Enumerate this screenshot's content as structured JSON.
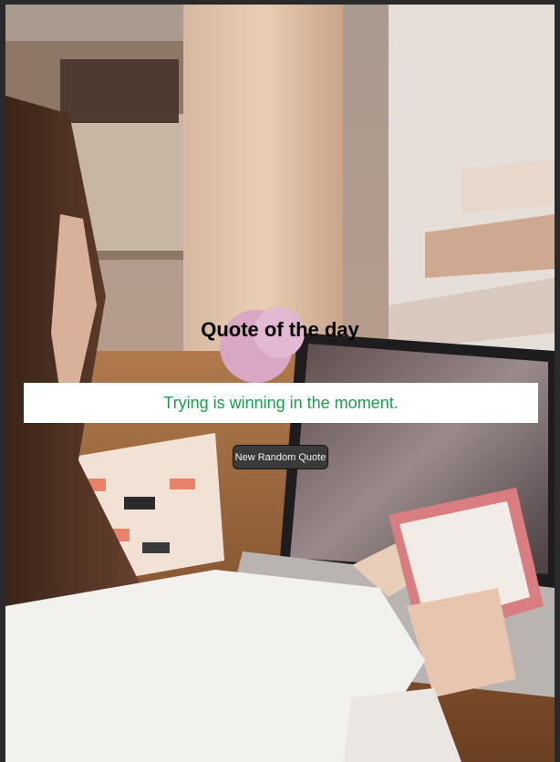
{
  "page": {
    "title": "Quote of the day",
    "quote": "Trying is winning in the moment.",
    "button_label": "New Random Quote"
  },
  "colors": {
    "quote_text": "#1e9a4f",
    "quote_box": "#ffffff",
    "button_bg": "#3a3a3a",
    "button_text": "#f2f2f2",
    "frame": "#2a2a2a"
  },
  "background": {
    "icon": "photo-woman-with-phone-and-laptop"
  }
}
